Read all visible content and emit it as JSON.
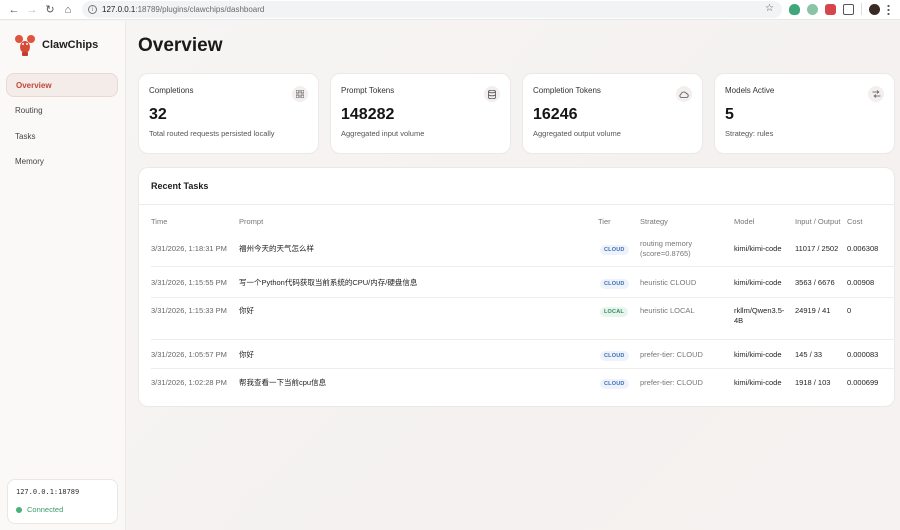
{
  "browser": {
    "url_host": "127.0.0.1",
    "url_path": ":18789/plugins/clawchips/dashboard"
  },
  "brand": {
    "name": "ClawChips"
  },
  "nav": [
    {
      "label": "Overview",
      "active": true
    },
    {
      "label": "Routing",
      "active": false
    },
    {
      "label": "Tasks",
      "active": false
    },
    {
      "label": "Memory",
      "active": false
    }
  ],
  "connection": {
    "host": "127.0.0.1:18789",
    "status": "Connected"
  },
  "page": {
    "title": "Overview"
  },
  "stats": [
    {
      "label": "Completions",
      "value": "32",
      "desc": "Total routed requests persisted locally",
      "icon": "grid-icon"
    },
    {
      "label": "Prompt Tokens",
      "value": "148282",
      "desc": "Aggregated input volume",
      "icon": "database-icon"
    },
    {
      "label": "Completion Tokens",
      "value": "16246",
      "desc": "Aggregated output volume",
      "icon": "cloud-icon"
    },
    {
      "label": "Models Active",
      "value": "5",
      "desc": "Strategy: rules",
      "icon": "shuffle-icon"
    }
  ],
  "tasks": {
    "title": "Recent Tasks",
    "columns": {
      "time": "Time",
      "prompt": "Prompt",
      "tier": "Tier",
      "strategy": "Strategy",
      "model": "Model",
      "io": "Input / Output",
      "cost": "Cost"
    },
    "rows": [
      {
        "time": "3/31/2026, 1:18:31 PM",
        "prompt": "福州今天的天气怎么样",
        "tier": "CLOUD",
        "strategy": "routing memory (score=0.8765)",
        "model": "kimi/kimi-code",
        "io": "11017 / 2502",
        "cost": "0.006308"
      },
      {
        "time": "3/31/2026, 1:15:55 PM",
        "prompt": "写一个Python代码获取当前系统的CPU/内存/硬盘信息",
        "tier": "CLOUD",
        "strategy": "heuristic CLOUD",
        "model": "kimi/kimi-code",
        "io": "3563 / 6676",
        "cost": "0.00908"
      },
      {
        "time": "3/31/2026, 1:15:33 PM",
        "prompt": "你好",
        "tier": "LOCAL",
        "strategy": "heuristic LOCAL",
        "model": "rkllm/Qwen3.5-4B",
        "io": "24919 / 41",
        "cost": "0"
      },
      {
        "time": "3/31/2026, 1:05:57 PM",
        "prompt": "你好",
        "tier": "CLOUD",
        "strategy": "prefer-tier: CLOUD",
        "model": "kimi/kimi-code",
        "io": "145 / 33",
        "cost": "0.000083"
      },
      {
        "time": "3/31/2026, 1:02:28 PM",
        "prompt": "帮我查看一下当前cpu信息",
        "tier": "CLOUD",
        "strategy": "prefer-tier: CLOUD",
        "model": "kimi/kimi-code",
        "io": "1918 / 103",
        "cost": "0.000699"
      }
    ]
  }
}
